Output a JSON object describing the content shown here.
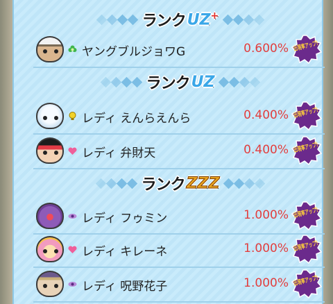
{
  "sections": [
    {
      "rank_label": "ランク",
      "tier": "UZ",
      "tier_mark": "+",
      "tier_icon": "rank-uz-plus-emblem",
      "rows": [
        {
          "name": "ヤングブルジョワG",
          "rate": "0.600%",
          "attribute_icon": "green-flower-icon",
          "badge": "出現率アップ!"
        }
      ]
    },
    {
      "rank_label": "ランク",
      "tier": "UZ",
      "tier_icon": "rank-uz-emblem",
      "rows": [
        {
          "name": "レディ えんらえんら",
          "rate": "0.400%",
          "attribute_icon": "yellow-bulb-icon",
          "badge": "出現率アップ!"
        },
        {
          "name": "レディ 弁財天",
          "rate": "0.400%",
          "attribute_icon": "pink-heart-icon",
          "badge": "出現率アップ!"
        }
      ]
    },
    {
      "rank_label": "ランク",
      "tier": "ZZZ",
      "tier_icon": "rank-zzz-emblem",
      "rows": [
        {
          "name": "レディ フゥミン",
          "rate": "1.000%",
          "attribute_icon": "purple-eye-icon",
          "badge": "出現率アップ!"
        },
        {
          "name": "レディ キレーネ",
          "rate": "1.000%",
          "attribute_icon": "pink-heart-icon",
          "badge": "出現率アップ!"
        },
        {
          "name": "レディ 呪野花子",
          "rate": "1.000%",
          "attribute_icon": "purple-eye-icon",
          "badge": "出現率アップ!"
        }
      ]
    }
  ],
  "colors": {
    "rate_text": "#e23d3d",
    "panel_bg": "#c9ebfb",
    "badge_purple": "#6b2a8c",
    "badge_text": "#ffd23a"
  }
}
